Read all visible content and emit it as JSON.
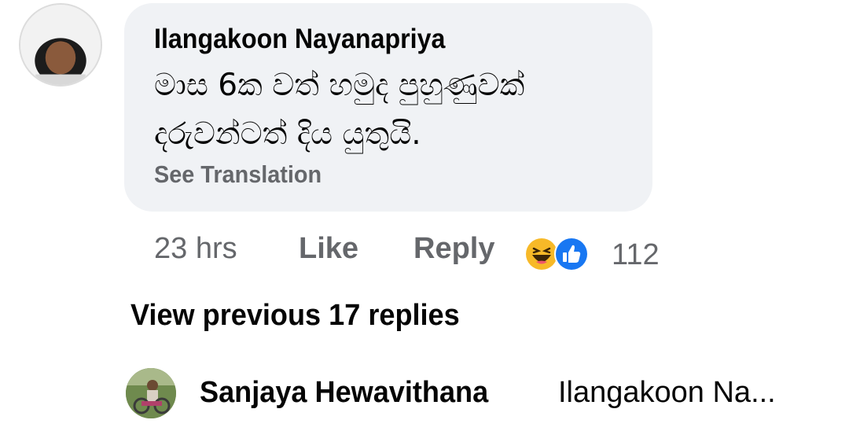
{
  "comment": {
    "author": "Ilangakoon Nayanapriya",
    "text": "මාස 6ක වත් හමුද පුහුණුවක් දරුවන්ටත් දිය යුතුයි.",
    "see_translation": "See Translation",
    "timestamp": "23 hrs",
    "like_label": "Like",
    "reply_label": "Reply",
    "reactions": [
      "haha-icon",
      "like-icon"
    ],
    "reaction_count": "112"
  },
  "view_previous": "View previous 17 replies",
  "reply": {
    "author": "Sanjaya Hewavithana",
    "preview": "Ilangakoon Na..."
  },
  "colors": {
    "bubble_bg": "#f0f2f5",
    "secondary_text": "#65676b",
    "like_blue": "#1877f2",
    "haha_yellow": "#f7b928"
  }
}
